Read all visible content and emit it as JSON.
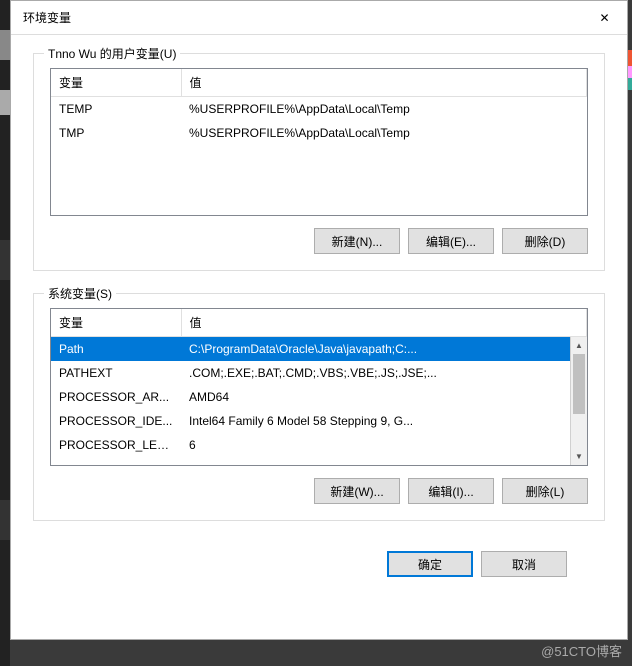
{
  "dialog": {
    "title": "环境变量",
    "close_icon": "✕"
  },
  "userGroup": {
    "label": "Tnno Wu 的用户变量(U)",
    "columns": {
      "var": "变量",
      "val": "值"
    },
    "rows": [
      {
        "var": "TEMP",
        "val": "%USERPROFILE%\\AppData\\Local\\Temp"
      },
      {
        "var": "TMP",
        "val": "%USERPROFILE%\\AppData\\Local\\Temp"
      }
    ],
    "buttons": {
      "new": "新建(N)...",
      "edit": "编辑(E)...",
      "delete": "删除(D)"
    }
  },
  "sysGroup": {
    "label": "系统变量(S)",
    "columns": {
      "var": "变量",
      "val": "值"
    },
    "rows": [
      {
        "var": "Path",
        "val": "C:\\ProgramData\\Oracle\\Java\\javapath;C:...",
        "selected": true
      },
      {
        "var": "PATHEXT",
        "val": ".COM;.EXE;.BAT;.CMD;.VBS;.VBE;.JS;.JSE;..."
      },
      {
        "var": "PROCESSOR_AR...",
        "val": "AMD64"
      },
      {
        "var": "PROCESSOR_IDE...",
        "val": "Intel64 Family 6 Model 58 Stepping 9, G..."
      },
      {
        "var": "PROCESSOR_LEV...",
        "val": "6"
      }
    ],
    "buttons": {
      "new": "新建(W)...",
      "edit": "编辑(I)...",
      "delete": "删除(L)"
    }
  },
  "footer": {
    "ok": "确定",
    "cancel": "取消"
  },
  "watermark": "@51CTO博客"
}
